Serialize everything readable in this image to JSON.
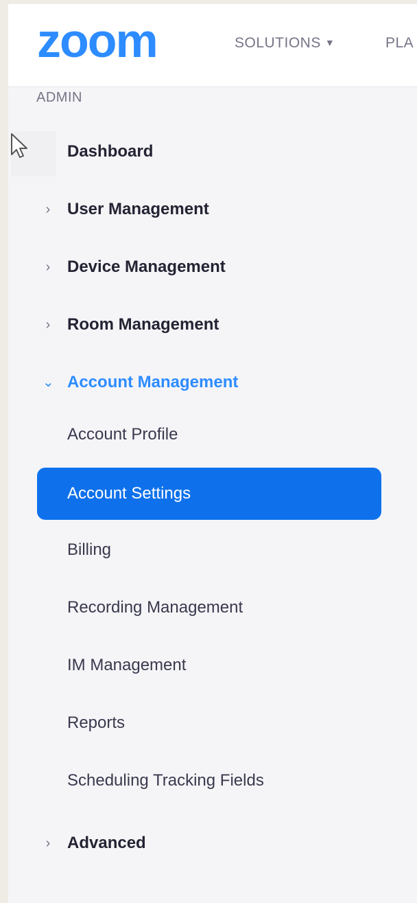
{
  "header": {
    "logo_text": "zoom",
    "nav": {
      "solutions_label": "SOLUTIONS",
      "plans_label": "PLA"
    },
    "brand_color": "#2d8cff"
  },
  "sidebar": {
    "section_label": "ADMIN",
    "items": {
      "dashboard": "Dashboard",
      "user_management": "User Management",
      "device_management": "Device Management",
      "room_management": "Room Management",
      "account_management": "Account Management",
      "account_profile": "Account Profile",
      "account_settings": "Account Settings",
      "billing": "Billing",
      "recording_management": "Recording Management",
      "im_management": "IM Management",
      "reports": "Reports",
      "scheduling_tracking_fields": "Scheduling Tracking Fields",
      "advanced": "Advanced"
    },
    "selected_item": "Account Settings",
    "selected_color": "#0e71eb"
  },
  "icons": {
    "expand": "chevron-right-icon",
    "collapse": "chevron-down-icon",
    "cursor": "mouse-pointer-icon",
    "dropdown": "caret-down-icon"
  }
}
